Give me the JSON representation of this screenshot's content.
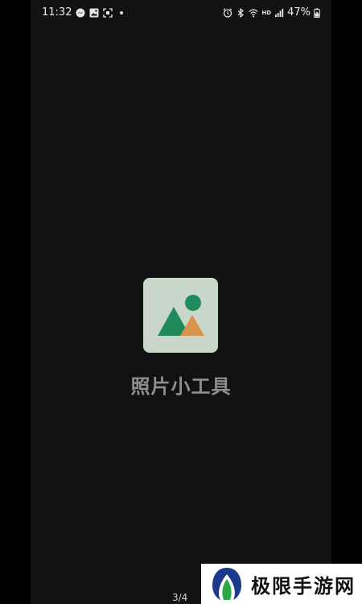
{
  "status_bar": {
    "time": "11:32",
    "battery_percent": "47%",
    "network_label": "HD",
    "icons_left": [
      "messenger-icon",
      "gallery-icon",
      "screenshot-icon",
      "notification-dot"
    ],
    "icons_right": [
      "alarm-icon",
      "bluetooth-icon",
      "wifi-icon",
      "signal-icon",
      "battery-icon"
    ]
  },
  "splash": {
    "app_name": "照片小工具",
    "icon": "photo-mountain-icon",
    "colors": {
      "background": "#121212",
      "icon_tile": "#c9d7cb",
      "mountain_green": "#1f8a5a",
      "mountain_orange": "#d9934a",
      "sun_green": "#1f8a5a",
      "title_text": "#8f8f8f"
    }
  },
  "pager": {
    "indicator": "3/4"
  },
  "watermark": {
    "text": "极限手游网",
    "logo": "site-logo-icon"
  }
}
